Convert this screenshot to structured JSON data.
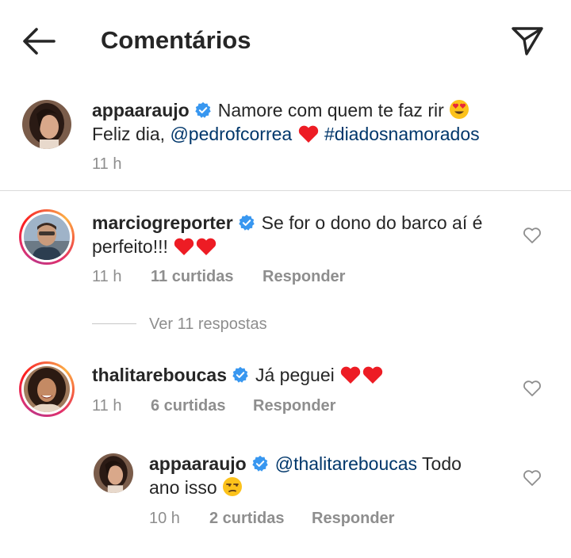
{
  "header": {
    "title": "Comentários",
    "back_icon": "arrow-left-icon",
    "share_icon": "paper-plane-icon"
  },
  "caption": {
    "username": "appaaraujo",
    "line1_text": "Namore com quem te faz rir",
    "line2_prefix": "Feliz dia,",
    "mention": "@pedrofcorrea",
    "hashtag": "#diadosnamorados",
    "time": "11 h"
  },
  "comments": [
    {
      "username": "marciogreporter",
      "text_line1": "Se for o dono do barco aí é",
      "text_line2": "perfeito!!!",
      "time": "11 h",
      "likes": "11 curtidas",
      "reply_label": "Responder"
    },
    {
      "username": "thalitareboucas",
      "text_line1": "Já peguei",
      "time": "11 h",
      "likes": "6 curtidas",
      "reply_label": "Responder"
    }
  ],
  "view_replies": "Ver 11 respostas",
  "reply": {
    "username": "appaaraujo",
    "mention": "@thalitareboucas",
    "text_after_mention": "Todo",
    "text_line2": "ano isso",
    "time": "10 h",
    "likes": "2 curtidas",
    "reply_label": "Responder"
  },
  "colors": {
    "text": "#262626",
    "secondary": "#8e8e8e",
    "link": "#00376b",
    "verified": "#3897f0",
    "heart": "#ed1c24",
    "divider": "#dbdbdb"
  }
}
